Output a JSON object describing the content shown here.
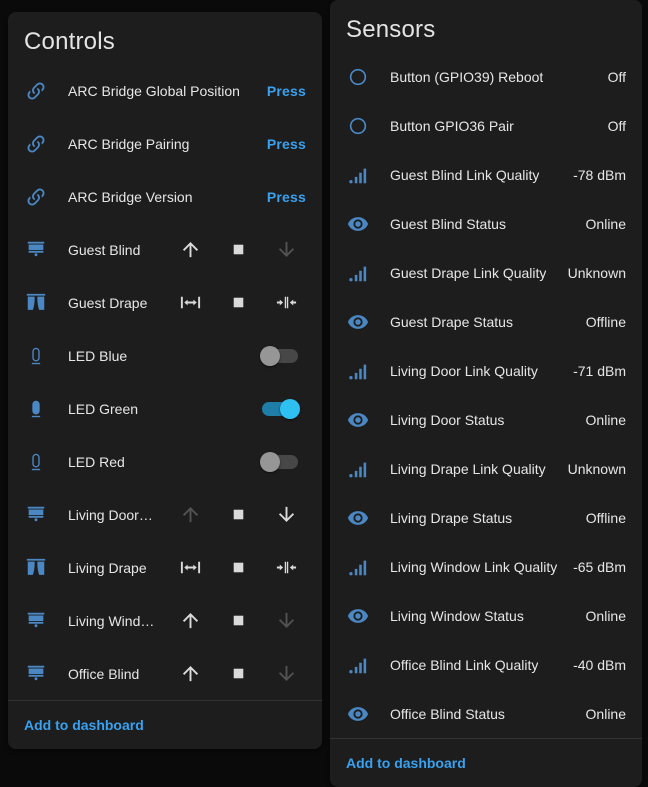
{
  "colors": {
    "accent": "#38a1f0",
    "entity_icon": "#4a87c3",
    "switch_on": "#2fc0f2",
    "card_background": "#1d1d1d",
    "page_background": "#0a0a0a"
  },
  "controls": {
    "title": "Controls",
    "footer_link": "Add to dashboard",
    "rows": [
      {
        "type": "press",
        "icon": "link-icon",
        "label": "ARC Bridge Global Position",
        "button": "Press"
      },
      {
        "type": "press",
        "icon": "link-icon",
        "label": "ARC Bridge Pairing",
        "button": "Press"
      },
      {
        "type": "press",
        "icon": "link-icon",
        "label": "ARC Bridge Version",
        "button": "Press"
      },
      {
        "type": "cover",
        "icon": "blind-icon",
        "label": "Guest Blind",
        "buttons": [
          {
            "name": "up",
            "enabled": true
          },
          {
            "name": "stop",
            "enabled": true
          },
          {
            "name": "down",
            "enabled": false
          }
        ]
      },
      {
        "type": "cover",
        "icon": "curtain-icon",
        "label": "Guest Drape",
        "buttons": [
          {
            "name": "open",
            "enabled": true
          },
          {
            "name": "stop",
            "enabled": true
          },
          {
            "name": "close",
            "enabled": true
          }
        ]
      },
      {
        "type": "toggle",
        "icon": "led-icon",
        "label": "LED Blue",
        "state": "off"
      },
      {
        "type": "toggle",
        "icon": "led-on-icon",
        "label": "LED Green",
        "state": "on"
      },
      {
        "type": "toggle",
        "icon": "led-icon",
        "label": "LED Red",
        "state": "off"
      },
      {
        "type": "cover",
        "icon": "blind-icon",
        "label": "Living Door…",
        "buttons": [
          {
            "name": "up",
            "enabled": false
          },
          {
            "name": "stop",
            "enabled": true
          },
          {
            "name": "down",
            "enabled": true
          }
        ]
      },
      {
        "type": "cover",
        "icon": "curtain-icon",
        "label": "Living Drape",
        "buttons": [
          {
            "name": "open",
            "enabled": true
          },
          {
            "name": "stop",
            "enabled": true
          },
          {
            "name": "close",
            "enabled": true
          }
        ]
      },
      {
        "type": "cover",
        "icon": "blind-icon",
        "label": "Living Wind…",
        "buttons": [
          {
            "name": "up",
            "enabled": true
          },
          {
            "name": "stop",
            "enabled": true
          },
          {
            "name": "down",
            "enabled": false
          }
        ]
      },
      {
        "type": "cover",
        "icon": "blind-icon",
        "label": "Office Blind",
        "buttons": [
          {
            "name": "up",
            "enabled": true
          },
          {
            "name": "stop",
            "enabled": true
          },
          {
            "name": "down",
            "enabled": false
          }
        ]
      }
    ]
  },
  "sensors": {
    "title": "Sensors",
    "footer_link": "Add to dashboard",
    "rows": [
      {
        "icon": "circle-icon",
        "label": "Button (GPIO39) Reboot",
        "value": "Off"
      },
      {
        "icon": "circle-icon",
        "label": "Button GPIO36 Pair",
        "value": "Off"
      },
      {
        "icon": "signal-icon",
        "label": "Guest Blind Link Quality",
        "value": "-78 dBm"
      },
      {
        "icon": "eye-icon",
        "label": "Guest Blind Status",
        "value": "Online"
      },
      {
        "icon": "signal-icon",
        "label": "Guest Drape Link Quality",
        "value": "Unknown"
      },
      {
        "icon": "eye-icon",
        "label": "Guest Drape Status",
        "value": "Offline"
      },
      {
        "icon": "signal-icon",
        "label": "Living Door Link Quality",
        "value": "-71 dBm"
      },
      {
        "icon": "eye-icon",
        "label": "Living Door Status",
        "value": "Online"
      },
      {
        "icon": "signal-icon",
        "label": "Living Drape Link Quality",
        "value": "Unknown"
      },
      {
        "icon": "eye-icon",
        "label": "Living Drape Status",
        "value": "Offline"
      },
      {
        "icon": "signal-icon",
        "label": "Living Window Link Quality",
        "value": "-65 dBm"
      },
      {
        "icon": "eye-icon",
        "label": "Living Window Status",
        "value": "Online"
      },
      {
        "icon": "signal-icon",
        "label": "Office Blind Link Quality",
        "value": "-40 dBm"
      },
      {
        "icon": "eye-icon",
        "label": "Office Blind Status",
        "value": "Online"
      }
    ]
  }
}
